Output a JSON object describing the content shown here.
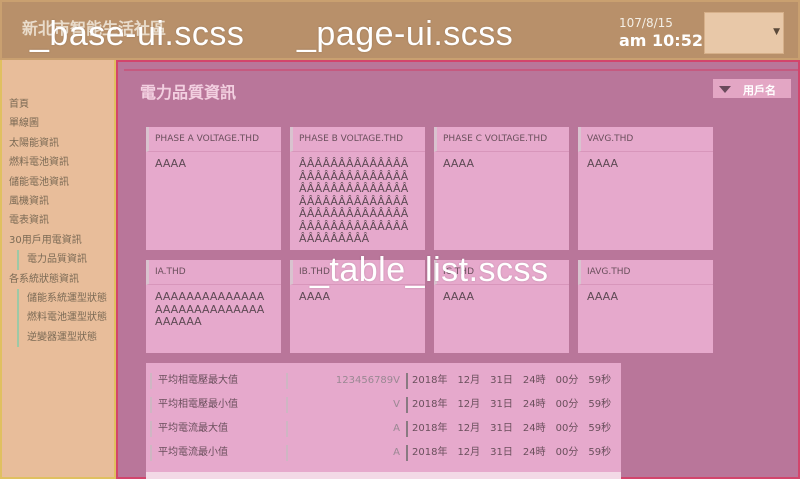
{
  "header": {
    "site_title": "新北市智能生活社區",
    "date": "107/8/15",
    "time": "am 10:52",
    "labels": {
      "base": "_base-ui.scss",
      "page": "_page-ui.scss",
      "table": "_table_list.scss"
    }
  },
  "sidebar": {
    "items": [
      {
        "label": "首頁"
      },
      {
        "label": "單線圖"
      },
      {
        "label": "太陽能資訊"
      },
      {
        "label": "燃料電池資訊"
      },
      {
        "label": "儲能電池資訊"
      },
      {
        "label": "風機資訊"
      },
      {
        "label": "電表資訊"
      },
      {
        "label": "30用戶用電資訊"
      },
      {
        "label": "電力品質資訊"
      },
      {
        "label": "各系統狀態資訊"
      },
      {
        "label": "儲能系統運型狀態"
      },
      {
        "label": "燃料電池運型狀態"
      },
      {
        "label": "逆變器運型狀態"
      }
    ]
  },
  "main": {
    "title": "電力品質資訊",
    "user_select": "用戶名"
  },
  "cards": [
    {
      "title": "PHASE A VOLTAGE.THD",
      "value": "AAAA"
    },
    {
      "title": "PHASE B VOLTAGE.THD",
      "value": "ÂÂÂÂÂÂÂÂÂÂÂÂÂÂÂÂÂÂÂÂÂÂÂÂÂÂÂÂÂÂÂÂÂÂÂÂÂÂÂÂÂÂÂÂÂÂÂÂÂÂÂÂÂÂÂÂÂÂÂÂÂÂÂÂÂÂÂÂÂÂÂÂÂÂÂÂÂÂÂÂÂÂÂÂÂÂÂÂÂÂÂÂÂ"
    },
    {
      "title": "PHASE C VOLTAGE.THD",
      "value": "AAAA"
    },
    {
      "title": "VAVG.THD",
      "value": "AAAA"
    },
    {
      "title": "IA.THD",
      "value": "AAAAAAAAAAAAAAAAAAAAAAAAAAAAAAAAAA"
    },
    {
      "title": "IB.THD",
      "value": "AAAA"
    },
    {
      "title": "IC.THD",
      "value": "AAAA"
    },
    {
      "title": "IAVG.THD",
      "value": "AAAA"
    }
  ],
  "table": {
    "rows": [
      {
        "label": "平均相電壓最大值",
        "value": "123456789V",
        "timestamp": "2018年　12月　31日　24時　00分　59秒"
      },
      {
        "label": "平均相電壓最小值",
        "value": "V",
        "timestamp": "2018年　12月　31日　24時　00分　59秒"
      },
      {
        "label": "平均電流最大值",
        "value": "A",
        "timestamp": "2018年　12月　31日　24時　00分　59秒"
      },
      {
        "label": "平均電流最小值",
        "value": "A",
        "timestamp": "2018年　12月　31日　24時　00分　59秒"
      }
    ]
  }
}
